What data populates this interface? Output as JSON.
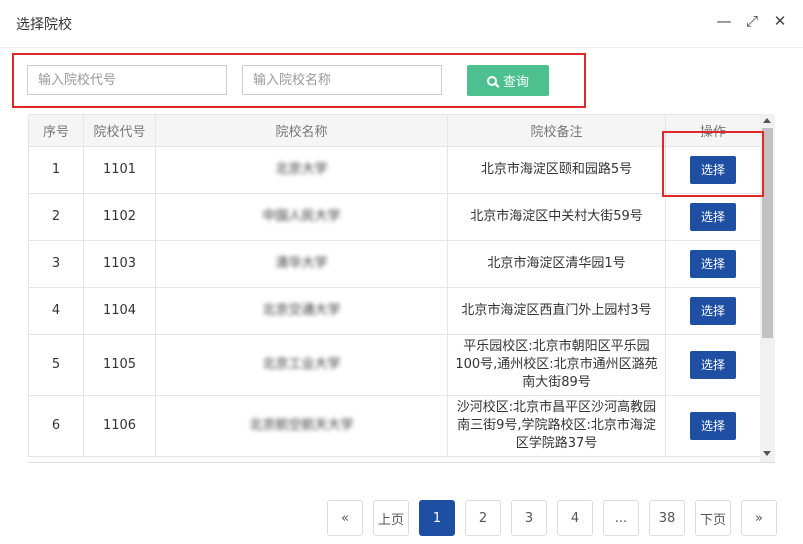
{
  "window": {
    "title": "选择院校",
    "minimize_icon": "minimize-icon",
    "maximize_icon": "maximize-icon",
    "close_icon": "close-icon"
  },
  "search": {
    "code_placeholder": "输入院校代号",
    "name_placeholder": "输入院校名称",
    "button_label": "查询"
  },
  "table": {
    "headers": [
      "序号",
      "院校代号",
      "院校名称",
      "院校备注",
      "操作"
    ],
    "rows": [
      {
        "no": "1",
        "code": "1101",
        "name": "北京大学",
        "note": "北京市海淀区颐和园路5号",
        "action": "选择"
      },
      {
        "no": "2",
        "code": "1102",
        "name": "中国人民大学",
        "note": "北京市海淀区中关村大街59号",
        "action": "选择"
      },
      {
        "no": "3",
        "code": "1103",
        "name": "清华大学",
        "note": "北京市海淀区清华园1号",
        "action": "选择"
      },
      {
        "no": "4",
        "code": "1104",
        "name": "北京交通大学",
        "note": "北京市海淀区西直门外上园村3号",
        "action": "选择"
      },
      {
        "no": "5",
        "code": "1105",
        "name": "北京工业大学",
        "note": "平乐园校区:北京市朝阳区平乐园100号,通州校区:北京市通州区潞苑南大街89号",
        "action": "选择"
      },
      {
        "no": "6",
        "code": "1106",
        "name": "北京航空航天大学",
        "note": "沙河校区:北京市昌平区沙河高教园南三街9号,学院路校区:北京市海淀区学院路37号",
        "action": "选择"
      }
    ]
  },
  "pagination": {
    "first": "«",
    "prev": "上页",
    "pages": [
      "1",
      "2",
      "3",
      "4",
      "...",
      "38"
    ],
    "next": "下页",
    "last": "»",
    "current": "1"
  },
  "colors": {
    "accent": "#1e4fa3",
    "search_button": "#4cc18f",
    "highlight": "#e0282a"
  }
}
